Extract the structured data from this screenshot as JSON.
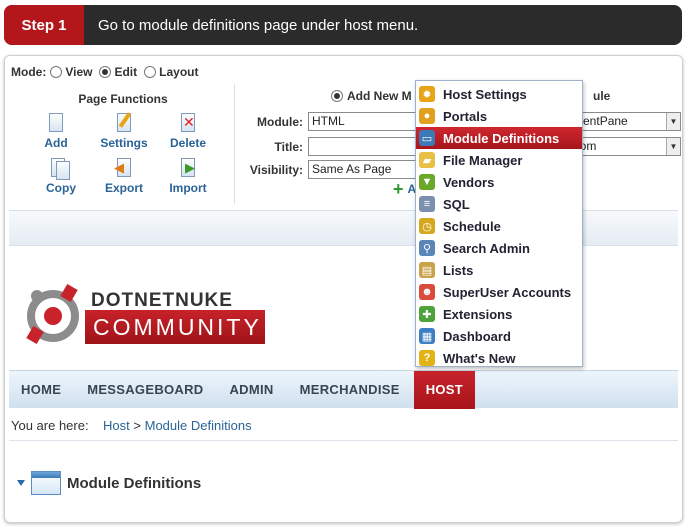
{
  "step": {
    "label": "Step 1",
    "text": "Go to module definitions page under host menu."
  },
  "control_panel": {
    "mode_label": "Mode:",
    "modes": [
      {
        "label": "View",
        "selected": false
      },
      {
        "label": "Edit",
        "selected": true
      },
      {
        "label": "Layout",
        "selected": false
      }
    ],
    "page_functions": {
      "title": "Page Functions",
      "buttons": [
        "Add",
        "Settings",
        "Delete",
        "Copy",
        "Export",
        "Import"
      ]
    },
    "add_module": {
      "radio_label": "Add New M",
      "right_partial": "ule",
      "module_label": "Module:",
      "module_value": "HTML",
      "title_label": "Title:",
      "title_value": "",
      "visibility_label": "Visibility:",
      "visibility_value": "Same As Page",
      "pane_value": "ntentPane",
      "position_value": "ttom",
      "add_button": "A"
    }
  },
  "logo": {
    "top": "DOTNETNUKE",
    "bottom": "COMMUNITY"
  },
  "nav": {
    "items": [
      "HOME",
      "MESSAGEBOARD",
      "ADMIN",
      "MERCHANDISE",
      "HOST"
    ],
    "active": "HOST"
  },
  "breadcrumb": {
    "prefix": "You are here:",
    "host": "Host",
    "sep": ">",
    "page": "Module Definitions"
  },
  "module_title": "Module Definitions",
  "host_menu": {
    "items": [
      {
        "label": "Host Settings",
        "icon": "gear-icon",
        "color": "#e8a317"
      },
      {
        "label": "Portals",
        "icon": "portals-icon",
        "color": "#e0a020"
      },
      {
        "label": "Module Definitions",
        "icon": "window-icon",
        "color": "#3b79b7",
        "selected": true
      },
      {
        "label": "File Manager",
        "icon": "folder-icon",
        "color": "#e9c046"
      },
      {
        "label": "Vendors",
        "icon": "vendors-icon",
        "color": "#6aa82a"
      },
      {
        "label": "SQL",
        "icon": "database-icon",
        "color": "#7d8fb0"
      },
      {
        "label": "Schedule",
        "icon": "clock-icon",
        "color": "#d6a820"
      },
      {
        "label": "Search Admin",
        "icon": "magnifier-icon",
        "color": "#5b86b8"
      },
      {
        "label": "Lists",
        "icon": "clipboard-icon",
        "color": "#c9a24a"
      },
      {
        "label": "SuperUser Accounts",
        "icon": "user-icon",
        "color": "#d94b3b"
      },
      {
        "label": "Extensions",
        "icon": "puzzle-icon",
        "color": "#4da43c"
      },
      {
        "label": "Dashboard",
        "icon": "dashboard-icon",
        "color": "#3d7fc4"
      },
      {
        "label": "What's New",
        "icon": "question-icon",
        "color": "#e2b316"
      }
    ]
  }
}
